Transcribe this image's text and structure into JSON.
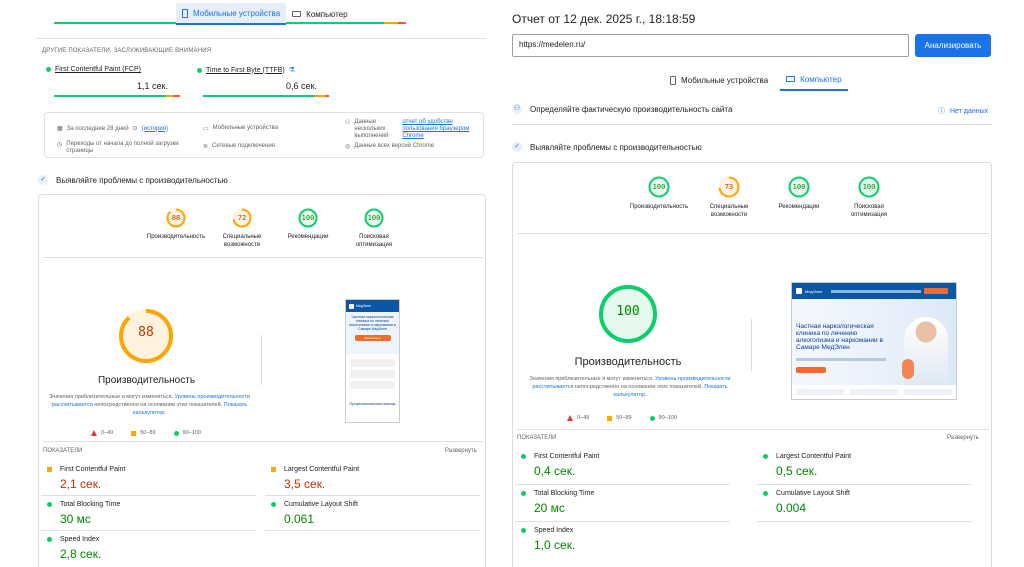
{
  "left": {
    "tabs": [
      {
        "label": "Мобильные устройства",
        "active": true
      },
      {
        "label": "Компьютер",
        "active": false
      }
    ],
    "other_metrics_heading": "ДРУГИЕ ПОКАЗАТЕЛИ, ЗАСЛУЖИВАЮЩИЕ ВНИМАНИЯ",
    "fcp": {
      "label": "First Contentful Paint (FCP)",
      "value": "1,1 сек."
    },
    "ttfb": {
      "label": "Time to First Byte (TTFB)",
      "value": "0,6 сек."
    },
    "info": {
      "period": "За последние 28 дней",
      "period_link": "(история)",
      "devices": "Мобильные устройства",
      "multi_label": "Данные нескольких выполнений",
      "multi_link": "отчет об удобстве пользования браузером Chrome",
      "transitions": "Переходы от начала до полной загрузки страницы",
      "network": "Сетевые подключения",
      "versions": "Данные всех версий Chrome"
    },
    "diagnose_heading": "Выявляйте проблемы с производительностью",
    "scores": [
      {
        "value": 88,
        "label": "Производительность",
        "color": "#ffa400"
      },
      {
        "value": 72,
        "label": "Специальные возможности",
        "color": "#ffa400"
      },
      {
        "value": 100,
        "label": "Рекомендации",
        "color": "#0cce6b"
      },
      {
        "value": 100,
        "label": "Поисковая оптимизация",
        "color": "#0cce6b"
      }
    ],
    "big_score": {
      "value": 88,
      "label": "Производительность"
    },
    "disclaimer_1": "Значения приблизительные и могут измениться.",
    "disclaimer_link_1": "Уровень производительности рассчитывается",
    "disclaimer_2": "непосредственно на основании этих показателей.",
    "disclaimer_link_2": "Показать калькулятор.",
    "legend": {
      "bad": "0–49",
      "mid": "50–89",
      "good": "90–100"
    },
    "metrics_heading": "ПОКАЗАТЕЛИ",
    "expand_label": "Развернуть",
    "metrics": [
      {
        "label": "First Contentful Paint",
        "value": "2,1 сек.",
        "status": "mid"
      },
      {
        "label": "Largest Contentful Paint",
        "value": "3,5 сек.",
        "status": "mid"
      },
      {
        "label": "Total Blocking Time",
        "value": "30 мс",
        "status": "good"
      },
      {
        "label": "Cumulative Layout Shift",
        "value": "0.061",
        "status": "good"
      },
      {
        "label": "Speed Index",
        "value": "2,8 сек.",
        "status": "good"
      }
    ],
    "preview": {
      "logo": "МедЭлен",
      "headline": "Частная наркологическая клиника по лечению алкоголизма и наркомании в Самаре МедЭлен",
      "button": "Записаться",
      "footer": "Профессиональная помощь"
    }
  },
  "right": {
    "report_title": "Отчет от 12 дек. 2025 г., 18:18:59",
    "url_value": "https://medelen.ru/",
    "analyze_button": "Анализировать",
    "tabs": [
      {
        "label": "Мобильные устройства",
        "active": false
      },
      {
        "label": "Компьютер",
        "active": true
      }
    ],
    "field_heading": "Определяйте фактическую производительность сайта",
    "no_data": "Нет данных",
    "diagnose_heading": "Выявляйте проблемы с производительностью",
    "scores": [
      {
        "value": 100,
        "label": "Производительность",
        "color": "#0cce6b"
      },
      {
        "value": 73,
        "label": "Специальные возможности",
        "color": "#ffa400"
      },
      {
        "value": 100,
        "label": "Рекомендации",
        "color": "#0cce6b"
      },
      {
        "value": 100,
        "label": "Поисковая оптимизация",
        "color": "#0cce6b"
      }
    ],
    "big_score": {
      "value": 100,
      "label": "Производительность"
    },
    "disclaimer_1": "Значения приблизительные и могут измениться.",
    "disclaimer_link_1": "Уровень производительности рассчитывается",
    "disclaimer_2": "непосредственно на основании этих показателей.",
    "disclaimer_link_2": "Показать калькулятор.",
    "legend": {
      "bad": "0–49",
      "mid": "50–89",
      "good": "90–100"
    },
    "metrics_heading": "ПОКАЗАТЕЛИ",
    "expand_label": "Развернуть",
    "metrics": [
      {
        "label": "First Contentful Paint",
        "value": "0,4 сек.",
        "status": "good"
      },
      {
        "label": "Largest Contentful Paint",
        "value": "0,5 сек.",
        "status": "good"
      },
      {
        "label": "Total Blocking Time",
        "value": "20 мс",
        "status": "good"
      },
      {
        "label": "Cumulative Layout Shift",
        "value": "0.004",
        "status": "good"
      },
      {
        "label": "Speed Index",
        "value": "1,0 сек.",
        "status": "good"
      }
    ],
    "preview": {
      "logo": "МедЭлен",
      "headline": "Частная наркологическая клиника по лечению алкоголизма и наркомании в Самаре МедЭлен"
    }
  },
  "colors": {
    "good": "#0cce6b",
    "mid": "#ffa400",
    "bad": "#ff4e42",
    "link": "#1a73e8"
  }
}
